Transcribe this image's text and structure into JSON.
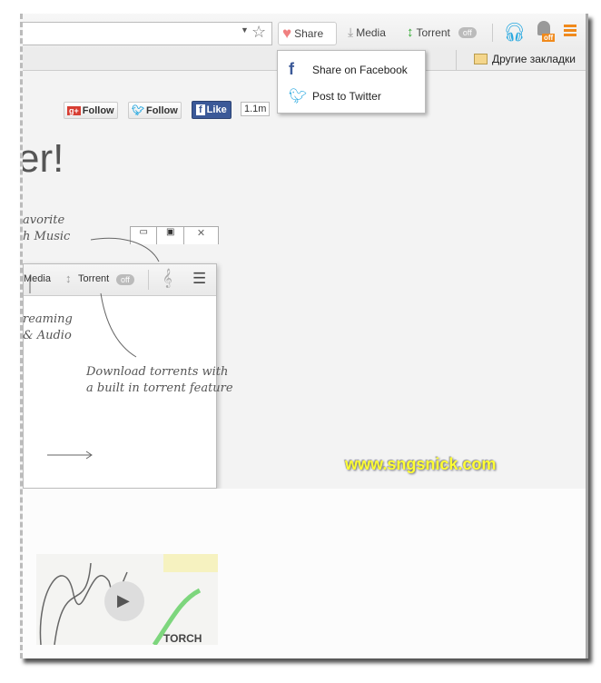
{
  "toolbar": {
    "share_label": "Share",
    "media_label": "Media",
    "torrent_label": "Torrent",
    "torrent_toggle": "off",
    "ghost_badge": "off"
  },
  "bookmarks": {
    "other_bookmarks": "Другие закладки"
  },
  "share_menu": {
    "items": [
      {
        "label": "Share on Facebook",
        "icon": "facebook-icon"
      },
      {
        "label": "Post to Twitter",
        "icon": "twitter-icon"
      }
    ]
  },
  "social": {
    "gplus_follow": "Follow",
    "twitter_follow": "Follow",
    "fb_like": "Like",
    "fb_count": "1.1m"
  },
  "hero": {
    "heading": "er!"
  },
  "mockup": {
    "media_label": "Media",
    "torrent_label": "Torrent",
    "torrent_toggle": "off",
    "note_music": [
      "avorite",
      "h Music"
    ],
    "note_streaming": [
      "reaming",
      "& Audio"
    ],
    "note_torrent": [
      "Download torrents with",
      "a built in torrent feature"
    ]
  },
  "watermark": "www.sngsnick.com",
  "video": {
    "brand": "TORCH"
  },
  "colors": {
    "accent_orange": "#f08a1c",
    "twitter_blue": "#2aa9e0",
    "facebook_blue": "#3b5998",
    "watermark_yellow": "#ffff33"
  }
}
